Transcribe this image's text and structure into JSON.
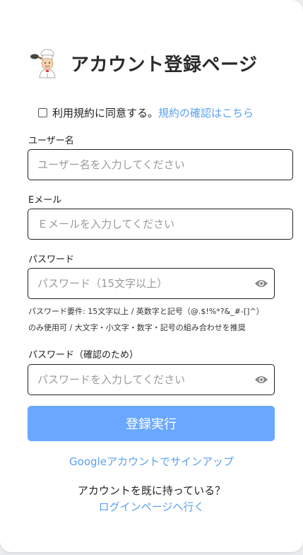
{
  "header": {
    "title": "アカウント登録ページ",
    "logo_icon": "chef-mascot-icon"
  },
  "terms": {
    "label": "利用規約に同意する。",
    "link": "規約の確認はこちら",
    "checked": false
  },
  "username": {
    "label": "ユーザー名",
    "placeholder": "ユーザー名を入力してください",
    "value": ""
  },
  "email": {
    "label": "Eメール",
    "placeholder": "Ｅメールを入力してください",
    "value": ""
  },
  "password": {
    "label": "パスワード",
    "placeholder": "パスワード（15文字以上）",
    "value": "",
    "hint_line1": "パスワード要件: 15文字以上 / 英数字と記号（@.$!%*?&_#-[]^）",
    "hint_line2": "のみ使用可 / 大文字・小文字・数字・記号の組み合わせを推奨",
    "toggle_icon": "eye-icon"
  },
  "password_confirm": {
    "label": "パスワード（確認のため）",
    "placeholder": "パスワードを入力してください",
    "value": "",
    "toggle_icon": "eye-icon"
  },
  "submit_label": "登録実行",
  "google_signup": "Googleアカウントでサインアップ",
  "login_prompt": "アカウントを既に持っている？",
  "login_link": "ログインページへ行く",
  "colors": {
    "accent": "#5aa0f0",
    "button": "#6aa8ff",
    "border": "#222222"
  }
}
